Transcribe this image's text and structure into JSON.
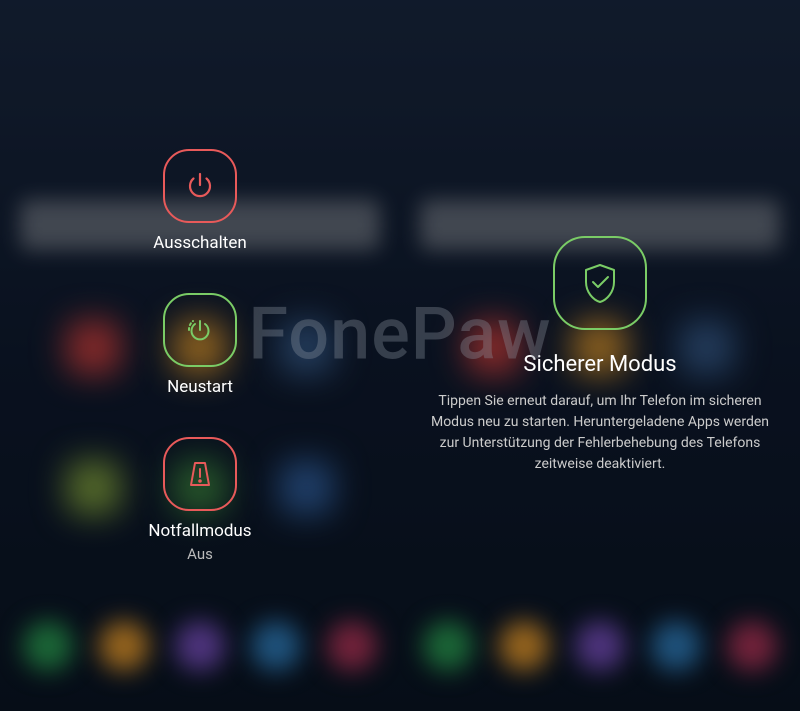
{
  "watermark": "FonePaw",
  "left": {
    "power_off": {
      "label": "Ausschalten"
    },
    "restart": {
      "label": "Neustart"
    },
    "emergency": {
      "label": "Notfallmodus",
      "status": "Aus"
    }
  },
  "right": {
    "title": "Sicherer Modus",
    "description": "Tippen Sie erneut darauf, um Ihr Telefon im sicheren Modus neu zu starten. Heruntergeladene Apps werden zur Unterstützung der Fehlerbehebung des Telefons zeitweise deaktiviert."
  }
}
